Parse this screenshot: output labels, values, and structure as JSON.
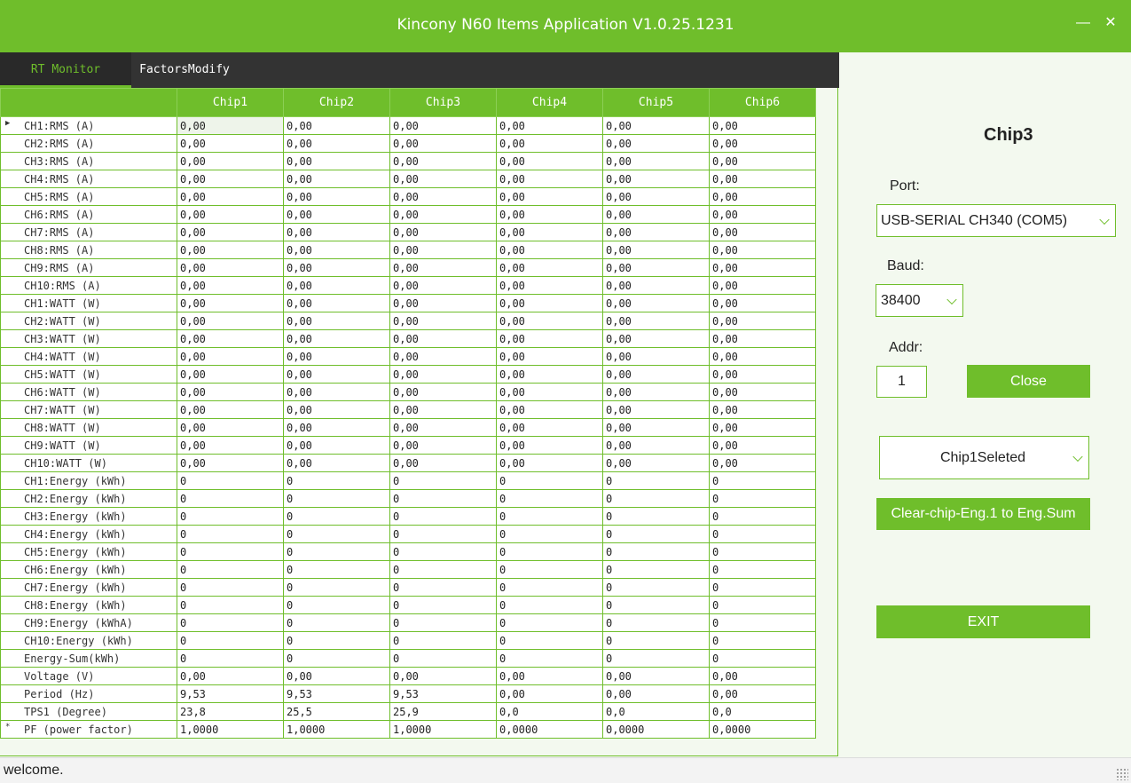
{
  "window": {
    "title": "Kincony N60 Items Application V1.0.25.1231",
    "minimize": "—",
    "close": "✕"
  },
  "tabs": [
    {
      "label": "RT Monitor"
    },
    {
      "label": "FactorsModify"
    }
  ],
  "grid": {
    "columns": [
      "Chip1",
      "Chip2",
      "Chip3",
      "Chip4",
      "Chip5",
      "Chip6"
    ],
    "rows": [
      {
        "label": "CH1:RMS (A)",
        "values": [
          "0,00",
          "0,00",
          "0,00",
          "0,00",
          "0,00",
          "0,00"
        ]
      },
      {
        "label": "CH2:RMS (A)",
        "values": [
          "0,00",
          "0,00",
          "0,00",
          "0,00",
          "0,00",
          "0,00"
        ]
      },
      {
        "label": "CH3:RMS (A)",
        "values": [
          "0,00",
          "0,00",
          "0,00",
          "0,00",
          "0,00",
          "0,00"
        ]
      },
      {
        "label": "CH4:RMS (A)",
        "values": [
          "0,00",
          "0,00",
          "0,00",
          "0,00",
          "0,00",
          "0,00"
        ]
      },
      {
        "label": "CH5:RMS (A)",
        "values": [
          "0,00",
          "0,00",
          "0,00",
          "0,00",
          "0,00",
          "0,00"
        ]
      },
      {
        "label": "CH6:RMS (A)",
        "values": [
          "0,00",
          "0,00",
          "0,00",
          "0,00",
          "0,00",
          "0,00"
        ]
      },
      {
        "label": "CH7:RMS (A)",
        "values": [
          "0,00",
          "0,00",
          "0,00",
          "0,00",
          "0,00",
          "0,00"
        ]
      },
      {
        "label": "CH8:RMS (A)",
        "values": [
          "0,00",
          "0,00",
          "0,00",
          "0,00",
          "0,00",
          "0,00"
        ]
      },
      {
        "label": "CH9:RMS (A)",
        "values": [
          "0,00",
          "0,00",
          "0,00",
          "0,00",
          "0,00",
          "0,00"
        ]
      },
      {
        "label": "CH10:RMS (A)",
        "values": [
          "0,00",
          "0,00",
          "0,00",
          "0,00",
          "0,00",
          "0,00"
        ]
      },
      {
        "label": "CH1:WATT (W)",
        "values": [
          "0,00",
          "0,00",
          "0,00",
          "0,00",
          "0,00",
          "0,00"
        ]
      },
      {
        "label": "CH2:WATT (W)",
        "values": [
          "0,00",
          "0,00",
          "0,00",
          "0,00",
          "0,00",
          "0,00"
        ]
      },
      {
        "label": "CH3:WATT (W)",
        "values": [
          "0,00",
          "0,00",
          "0,00",
          "0,00",
          "0,00",
          "0,00"
        ]
      },
      {
        "label": "CH4:WATT (W)",
        "values": [
          "0,00",
          "0,00",
          "0,00",
          "0,00",
          "0,00",
          "0,00"
        ]
      },
      {
        "label": "CH5:WATT (W)",
        "values": [
          "0,00",
          "0,00",
          "0,00",
          "0,00",
          "0,00",
          "0,00"
        ]
      },
      {
        "label": "CH6:WATT (W)",
        "values": [
          "0,00",
          "0,00",
          "0,00",
          "0,00",
          "0,00",
          "0,00"
        ]
      },
      {
        "label": "CH7:WATT (W)",
        "values": [
          "0,00",
          "0,00",
          "0,00",
          "0,00",
          "0,00",
          "0,00"
        ]
      },
      {
        "label": "CH8:WATT (W)",
        "values": [
          "0,00",
          "0,00",
          "0,00",
          "0,00",
          "0,00",
          "0,00"
        ]
      },
      {
        "label": "CH9:WATT (W)",
        "values": [
          "0,00",
          "0,00",
          "0,00",
          "0,00",
          "0,00",
          "0,00"
        ]
      },
      {
        "label": "CH10:WATT (W)",
        "values": [
          "0,00",
          "0,00",
          "0,00",
          "0,00",
          "0,00",
          "0,00"
        ]
      },
      {
        "label": "CH1:Energy (kWh)",
        "values": [
          "0",
          "0",
          "0",
          "0",
          "0",
          "0"
        ]
      },
      {
        "label": "CH2:Energy (kWh)",
        "values": [
          "0",
          "0",
          "0",
          "0",
          "0",
          "0"
        ]
      },
      {
        "label": "CH3:Energy (kWh)",
        "values": [
          "0",
          "0",
          "0",
          "0",
          "0",
          "0"
        ]
      },
      {
        "label": "CH4:Energy (kWh)",
        "values": [
          "0",
          "0",
          "0",
          "0",
          "0",
          "0"
        ]
      },
      {
        "label": "CH5:Energy (kWh)",
        "values": [
          "0",
          "0",
          "0",
          "0",
          "0",
          "0"
        ]
      },
      {
        "label": "CH6:Energy (kWh)",
        "values": [
          "0",
          "0",
          "0",
          "0",
          "0",
          "0"
        ]
      },
      {
        "label": "CH7:Energy (kWh)",
        "values": [
          "0",
          "0",
          "0",
          "0",
          "0",
          "0"
        ]
      },
      {
        "label": "CH8:Energy (kWh)",
        "values": [
          "0",
          "0",
          "0",
          "0",
          "0",
          "0"
        ]
      },
      {
        "label": "CH9:Energy (kWhA)",
        "values": [
          "0",
          "0",
          "0",
          "0",
          "0",
          "0"
        ]
      },
      {
        "label": "CH10:Energy (kWh)",
        "values": [
          "0",
          "0",
          "0",
          "0",
          "0",
          "0"
        ]
      },
      {
        "label": "Energy-Sum(kWh)",
        "values": [
          "0",
          "0",
          "0",
          "0",
          "0",
          "0"
        ]
      },
      {
        "label": "Voltage (V)",
        "values": [
          "0,00",
          "0,00",
          "0,00",
          "0,00",
          "0,00",
          "0,00"
        ]
      },
      {
        "label": "Period (Hz)",
        "values": [
          "9,53",
          "9,53",
          "9,53",
          "0,00",
          "0,00",
          "0,00"
        ]
      },
      {
        "label": "TPS1 (Degree)",
        "values": [
          "23,8",
          "25,5",
          "25,9",
          "0,0",
          "0,0",
          "0,0"
        ]
      },
      {
        "label": "PF (power factor)",
        "values": [
          "1,0000",
          "1,0000",
          "1,0000",
          "0,0000",
          "0,0000",
          "0,0000"
        ]
      }
    ]
  },
  "side": {
    "chip_label": "Chip3",
    "port_label": "Port:",
    "port_value": "USB-SERIAL CH340 (COM5)",
    "baud_label": "Baud:",
    "baud_value": "38400",
    "addr_label": "Addr:",
    "addr_value": "1",
    "close_button": "Close",
    "chip_select_value": "Chip1Seleted",
    "clear_button": "Clear-chip-Eng.1 to Eng.Sum",
    "exit_button": "EXIT"
  },
  "status": {
    "text": "welcome."
  }
}
